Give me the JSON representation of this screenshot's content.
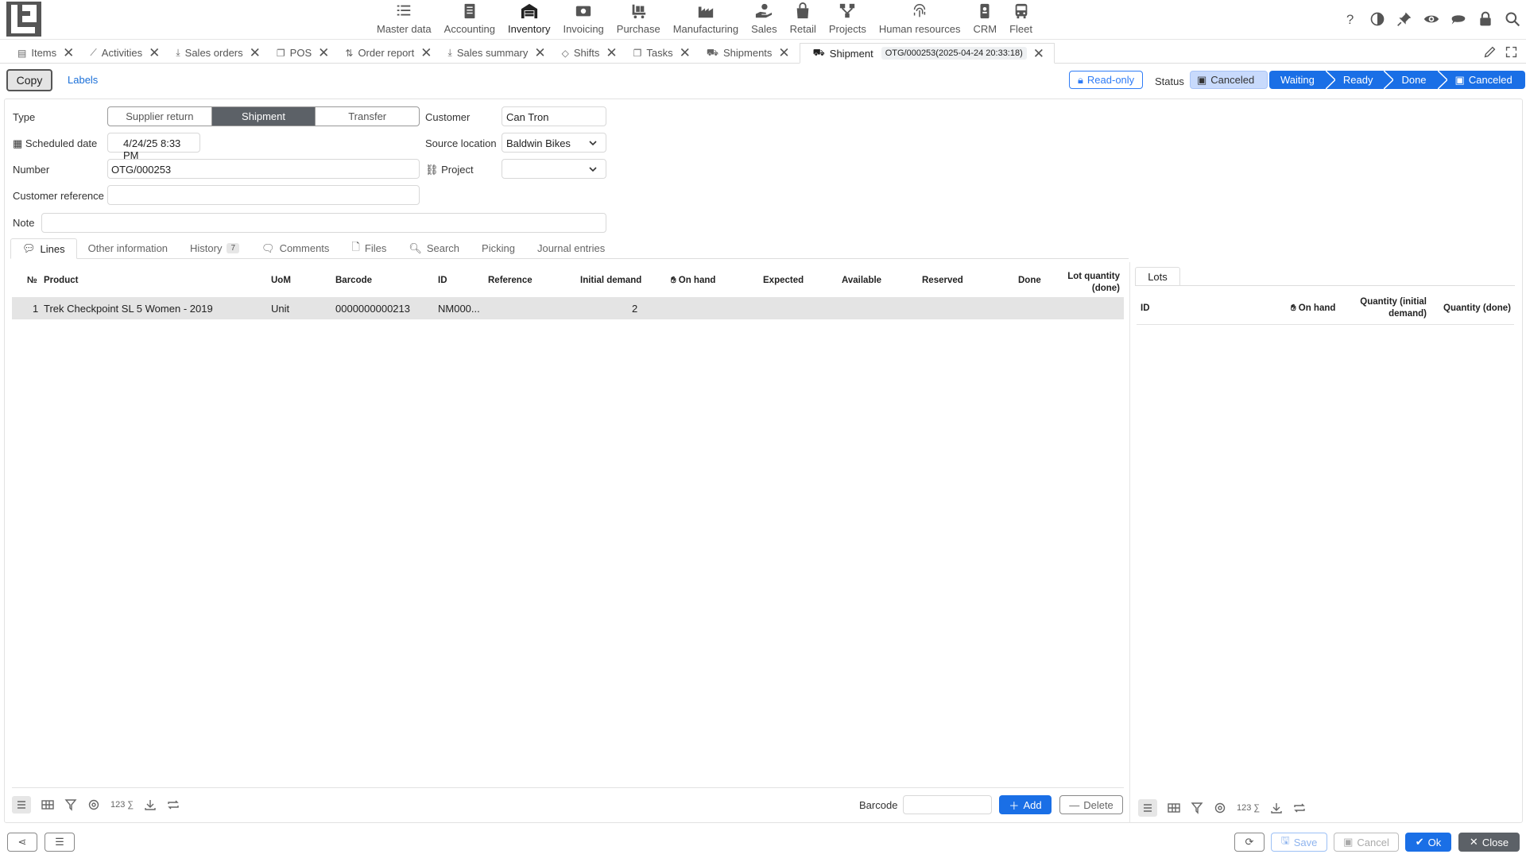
{
  "nav": {
    "modules": [
      {
        "label": "Master data",
        "icon": "checklist-icon"
      },
      {
        "label": "Accounting",
        "icon": "ledger-icon"
      },
      {
        "label": "Inventory",
        "icon": "warehouse-icon",
        "active": true
      },
      {
        "label": "Invoicing",
        "icon": "banknote-icon"
      },
      {
        "label": "Purchase",
        "icon": "cart-icon"
      },
      {
        "label": "Manufacturing",
        "icon": "factory-icon"
      },
      {
        "label": "Sales",
        "icon": "hand-coin-icon"
      },
      {
        "label": "Retail",
        "icon": "shopping-bag-icon"
      },
      {
        "label": "Projects",
        "icon": "hierarchy-icon"
      },
      {
        "label": "Human resources",
        "icon": "fingerprint-icon"
      },
      {
        "label": "CRM",
        "icon": "phone-icon"
      },
      {
        "label": "Fleet",
        "icon": "bus-icon"
      }
    ]
  },
  "tabs": [
    {
      "label": "Items"
    },
    {
      "label": "Activities"
    },
    {
      "label": "Sales orders"
    },
    {
      "label": "POS"
    },
    {
      "label": "Order report"
    },
    {
      "label": "Sales summary"
    },
    {
      "label": "Shifts"
    },
    {
      "label": "Tasks"
    },
    {
      "label": "Shipments"
    },
    {
      "label": "Shipment",
      "doc": "OTG/000253(2025-04-24 20:33:18)",
      "active": true
    }
  ],
  "toolbar": {
    "copy": "Copy",
    "labels": "Labels",
    "readonly": "Read-only",
    "status_label": "Status",
    "status_value": "Canceled",
    "steps": [
      "Waiting",
      "Ready",
      "Done",
      "Canceled"
    ]
  },
  "form": {
    "type_label": "Type",
    "type_options": [
      "Supplier return",
      "Shipment",
      "Transfer"
    ],
    "type_selected": "Shipment",
    "scheduled_label": "Scheduled date",
    "scheduled_value": "4/24/25 8:33 PM",
    "number_label": "Number",
    "number_value": "OTG/000253",
    "custref_label": "Customer reference",
    "custref_value": "",
    "note_label": "Note",
    "note_value": "",
    "customer_label": "Customer",
    "customer_value": "Can Tron",
    "source_label": "Source location",
    "source_value": "Baldwin Bikes",
    "project_label": "Project",
    "project_value": ""
  },
  "inner_tabs": [
    {
      "label": "Lines",
      "active": true
    },
    {
      "label": "Other information"
    },
    {
      "label": "History",
      "count": "7"
    },
    {
      "label": "Comments"
    },
    {
      "label": "Files"
    },
    {
      "label": "Search"
    },
    {
      "label": "Picking"
    },
    {
      "label": "Journal entries"
    }
  ],
  "lines": {
    "columns": [
      "№",
      "Product",
      "UoM",
      "Barcode",
      "ID",
      "Reference",
      "Initial demand",
      "On hand",
      "Expected",
      "Available",
      "Reserved",
      "Done",
      "Lot quantity",
      "(done)"
    ],
    "rows": [
      {
        "n": "1",
        "product": "Trek Checkpoint SL 5 Women - 2019",
        "uom": "Unit",
        "barcode": "0000000000213",
        "id": "NM000...",
        "reference": "",
        "initial": "2"
      }
    ]
  },
  "lots": {
    "tab": "Lots",
    "columns": [
      "ID",
      "On hand",
      "Quantity (initial",
      "demand)",
      "Quantity (done)"
    ]
  },
  "grid_footer": {
    "barcode_label": "Barcode",
    "barcode_value": "",
    "add": "Add",
    "delete": "Delete",
    "num_label": "123"
  },
  "bottom": {
    "save": "Save",
    "cancel": "Cancel",
    "ok": "Ok",
    "close": "Close"
  },
  "colors": {
    "accent": "#1a6fe6",
    "status_bg": "#c8dafc"
  }
}
